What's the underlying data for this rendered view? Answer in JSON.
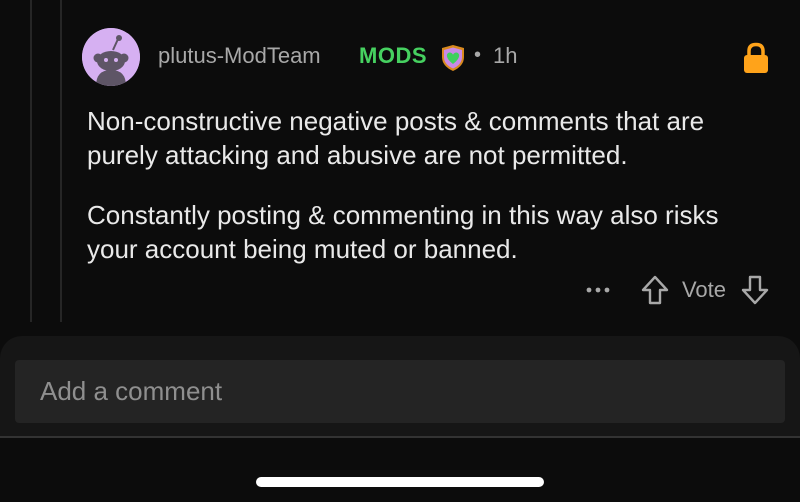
{
  "comment": {
    "author": "plutus-ModTeam",
    "flair": "MODS",
    "separator": "•",
    "age": "1h",
    "paragraphs": [
      "Non-constructive negative posts & comments that are purely attacking and abusive are not permitted.",
      "Constantly posting & commenting in this way also risks your account being muted or banned."
    ],
    "vote_label": "Vote",
    "more_label": "•••",
    "locked": true
  },
  "composer": {
    "placeholder": "Add a comment"
  },
  "icons": {
    "avatar": "snoo-avatar-icon",
    "mod_shield": "mod-shield-icon",
    "lock": "lock-icon",
    "upvote": "upvote-arrow-icon",
    "downvote": "downvote-arrow-icon",
    "more": "more-options-icon"
  },
  "colors": {
    "background": "#0c0c0c",
    "text_primary": "#e9e9e9",
    "text_secondary": "#a8a8a8",
    "mod_green": "#46d160",
    "lock_orange": "#ffa31a",
    "avatar_bg": "#d6b0f2",
    "input_bg": "#242424"
  }
}
